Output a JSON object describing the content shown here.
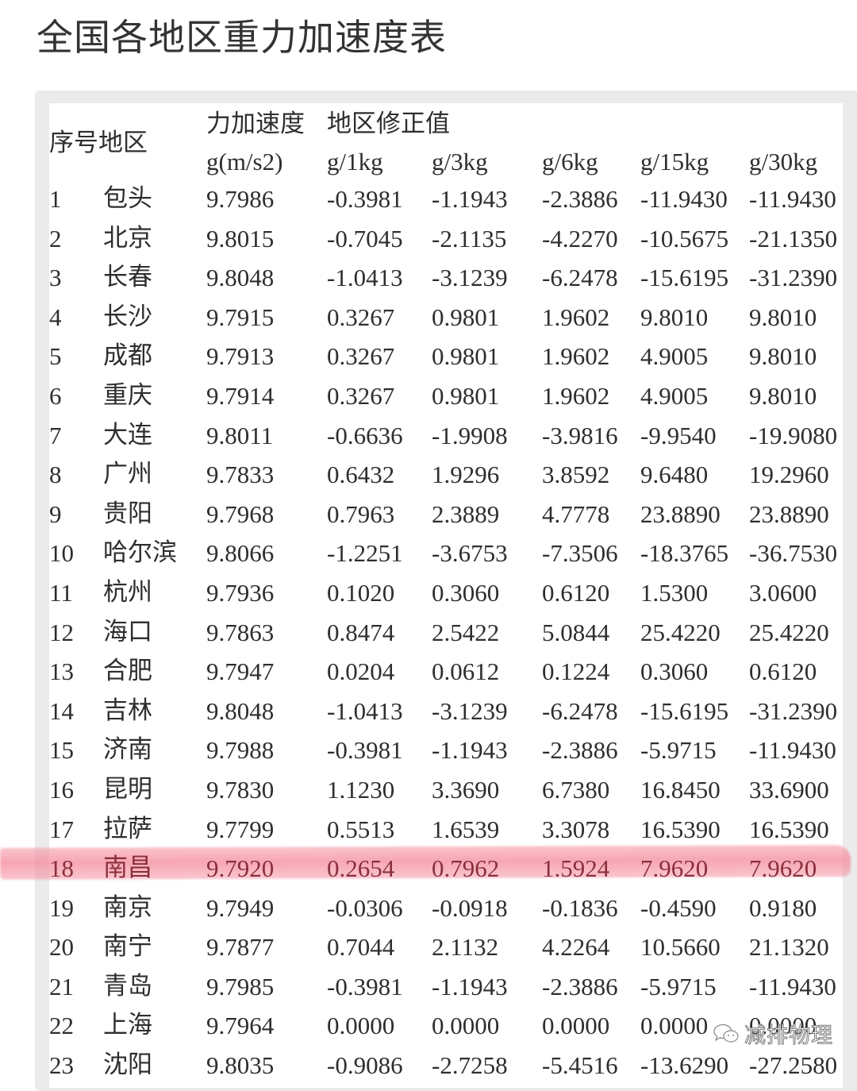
{
  "page": {
    "title": "全国各地区重力加速度表"
  },
  "table": {
    "header": {
      "index_region": "序号地区",
      "gravity": "力加速度",
      "correction_group": "地区修正值",
      "units": [
        "g(m/s2)",
        "g/1kg",
        "g/3kg",
        "g/6kg",
        "g/15kg",
        "g/30kg"
      ]
    },
    "highlight_color": "#f48c9e",
    "highlighted_index": "18",
    "rows": [
      {
        "idx": "1",
        "region": "包头",
        "g": "9.7986",
        "c1": "-0.3981",
        "c3": "-1.1943",
        "c6": "-2.3886",
        "c15": "-11.9430",
        "c30": "-11.9430"
      },
      {
        "idx": "2",
        "region": "北京",
        "g": "9.8015",
        "c1": "-0.7045",
        "c3": "-2.1135",
        "c6": "-4.2270",
        "c15": "-10.5675",
        "c30": "-21.1350"
      },
      {
        "idx": "3",
        "region": "长春",
        "g": "9.8048",
        "c1": "-1.0413",
        "c3": "-3.1239",
        "c6": "-6.2478",
        "c15": "-15.6195",
        "c30": "-31.2390"
      },
      {
        "idx": "4",
        "region": "长沙",
        "g": "9.7915",
        "c1": "0.3267",
        "c3": "0.9801",
        "c6": "1.9602",
        "c15": "9.8010",
        "c30": "9.8010"
      },
      {
        "idx": "5",
        "region": "成都",
        "g": "9.7913",
        "c1": "0.3267",
        "c3": "0.9801",
        "c6": "1.9602",
        "c15": "4.9005",
        "c30": "9.8010"
      },
      {
        "idx": "6",
        "region": "重庆",
        "g": "9.7914",
        "c1": "0.3267",
        "c3": "0.9801",
        "c6": "1.9602",
        "c15": "4.9005",
        "c30": "9.8010"
      },
      {
        "idx": "7",
        "region": "大连",
        "g": "9.8011",
        "c1": "-0.6636",
        "c3": "-1.9908",
        "c6": "-3.9816",
        "c15": "-9.9540",
        "c30": "-19.9080"
      },
      {
        "idx": "8",
        "region": "广州",
        "g": "9.7833",
        "c1": "0.6432",
        "c3": "1.9296",
        "c6": "3.8592",
        "c15": "9.6480",
        "c30": "19.2960"
      },
      {
        "idx": "9",
        "region": "贵阳",
        "g": "9.7968",
        "c1": "0.7963",
        "c3": "2.3889",
        "c6": "4.7778",
        "c15": "23.8890",
        "c30": "23.8890"
      },
      {
        "idx": "10",
        "region": "哈尔滨",
        "g": "9.8066",
        "c1": "-1.2251",
        "c3": "-3.6753",
        "c6": "-7.3506",
        "c15": "-18.3765",
        "c30": "-36.7530"
      },
      {
        "idx": "11",
        "region": "杭州",
        "g": "9.7936",
        "c1": "0.1020",
        "c3": "0.3060",
        "c6": "0.6120",
        "c15": "1.5300",
        "c30": "3.0600"
      },
      {
        "idx": "12",
        "region": "海口",
        "g": "9.7863",
        "c1": "0.8474",
        "c3": "2.5422",
        "c6": "5.0844",
        "c15": "25.4220",
        "c30": "25.4220"
      },
      {
        "idx": "13",
        "region": "合肥",
        "g": "9.7947",
        "c1": "0.0204",
        "c3": "0.0612",
        "c6": "0.1224",
        "c15": "0.3060",
        "c30": "0.6120"
      },
      {
        "idx": "14",
        "region": "吉林",
        "g": "9.8048",
        "c1": "-1.0413",
        "c3": "-3.1239",
        "c6": "-6.2478",
        "c15": "-15.6195",
        "c30": "-31.2390"
      },
      {
        "idx": "15",
        "region": "济南",
        "g": "9.7988",
        "c1": "-0.3981",
        "c3": "-1.1943",
        "c6": "-2.3886",
        "c15": "-5.9715",
        "c30": "-11.9430"
      },
      {
        "idx": "16",
        "region": "昆明",
        "g": "9.7830",
        "c1": "1.1230",
        "c3": "3.3690",
        "c6": "6.7380",
        "c15": "16.8450",
        "c30": "33.6900"
      },
      {
        "idx": "17",
        "region": "拉萨",
        "g": "9.7799",
        "c1": "0.5513",
        "c3": "1.6539",
        "c6": "3.3078",
        "c15": "16.5390",
        "c30": "16.5390"
      },
      {
        "idx": "18",
        "region": "南昌",
        "g": "9.7920",
        "c1": "0.2654",
        "c3": "0.7962",
        "c6": "1.5924",
        "c15": "7.9620",
        "c30": "7.9620"
      },
      {
        "idx": "19",
        "region": "南京",
        "g": "9.7949",
        "c1": "-0.0306",
        "c3": "-0.0918",
        "c6": "-0.1836",
        "c15": "-0.4590",
        "c30": "0.9180"
      },
      {
        "idx": "20",
        "region": "南宁",
        "g": "9.7877",
        "c1": "0.7044",
        "c3": "2.1132",
        "c6": "4.2264",
        "c15": "10.5660",
        "c30": "21.1320"
      },
      {
        "idx": "21",
        "region": "青岛",
        "g": "9.7985",
        "c1": "-0.3981",
        "c3": "-1.1943",
        "c6": "-2.3886",
        "c15": "-5.9715",
        "c30": "-11.9430"
      },
      {
        "idx": "22",
        "region": "上海",
        "g": "9.7964",
        "c1": "0.0000",
        "c3": "0.0000",
        "c6": "0.0000",
        "c15": "0.0000",
        "c30": "0.0000"
      },
      {
        "idx": "23",
        "region": "沈阳",
        "g": "9.8035",
        "c1": "-0.9086",
        "c3": "-2.7258",
        "c6": "-5.4516",
        "c15": "-13.6290",
        "c30": "-27.2580"
      }
    ]
  },
  "watermark": {
    "icon": "wechat-icon",
    "text": "减排物理"
  }
}
